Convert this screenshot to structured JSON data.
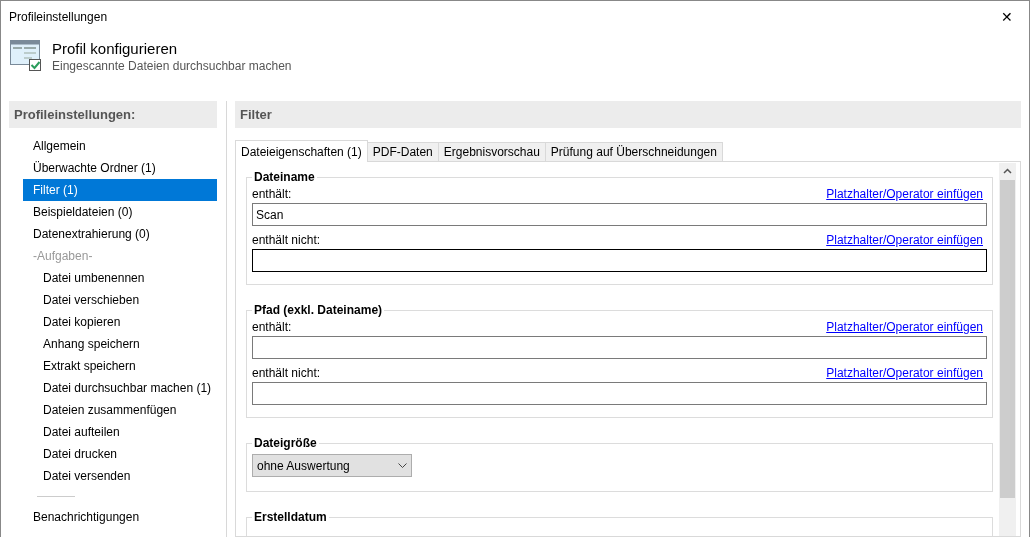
{
  "window": {
    "title": "Profileinstellungen",
    "close": "✕"
  },
  "header": {
    "title": "Profil konfigurieren",
    "subtitle": "Eingescannte Dateien durchsuchbar machen"
  },
  "sidebar": {
    "title": "Profileinstellungen:",
    "items": [
      {
        "kind": "item",
        "label": "Allgemein",
        "selected": false
      },
      {
        "kind": "item",
        "label": "Überwachte Ordner (1)",
        "selected": false
      },
      {
        "kind": "item",
        "label": "Filter (1)",
        "selected": true
      },
      {
        "kind": "item",
        "label": "Beispieldateien (0)",
        "selected": false
      },
      {
        "kind": "item",
        "label": "Datenextrahierung (0)",
        "selected": false
      },
      {
        "kind": "heading",
        "label": "-Aufgaben-"
      },
      {
        "kind": "subitem",
        "label": "Datei umbenennen",
        "selected": false
      },
      {
        "kind": "subitem",
        "label": "Datei verschieben",
        "selected": false
      },
      {
        "kind": "subitem",
        "label": "Datei kopieren",
        "selected": false
      },
      {
        "kind": "subitem",
        "label": "Anhang speichern",
        "selected": false
      },
      {
        "kind": "subitem",
        "label": "Extrakt speichern",
        "selected": false
      },
      {
        "kind": "subitem",
        "label": "Datei durchsuchbar machen (1)",
        "selected": false
      },
      {
        "kind": "subitem",
        "label": "Dateien zusammenfügen",
        "selected": false
      },
      {
        "kind": "subitem",
        "label": "Datei aufteilen",
        "selected": false
      },
      {
        "kind": "subitem",
        "label": "Datei drucken",
        "selected": false
      },
      {
        "kind": "subitem",
        "label": "Datei versenden",
        "selected": false
      },
      {
        "kind": "separator"
      },
      {
        "kind": "item",
        "label": "Benachrichtigungen",
        "selected": false
      }
    ]
  },
  "panel": {
    "title": "Filter",
    "tabs": [
      {
        "label": "Dateieigenschaften (1)",
        "selected": true
      },
      {
        "label": "PDF-Daten",
        "selected": false
      },
      {
        "label": "Ergebnisvorschau",
        "selected": false
      },
      {
        "label": "Prüfung auf Überschneidungen",
        "selected": false
      }
    ],
    "groups": [
      {
        "kind": "text",
        "title": "Dateiname",
        "fields": [
          {
            "label": "enthält:",
            "link": "Platzhalter/Operator einfügen",
            "value": "Scan",
            "focused": false
          },
          {
            "label": "enthält nicht:",
            "link": "Platzhalter/Operator einfügen",
            "focused": true
          }
        ]
      },
      {
        "kind": "text",
        "title": "Pfad (exkl. Dateiname)",
        "fields": [
          {
            "label": "enthält:",
            "link": "Platzhalter/Operator einfügen",
            "focused": false
          },
          {
            "label": "enthält nicht:",
            "link": "Platzhalter/Operator einfügen",
            "focused": false
          }
        ]
      },
      {
        "kind": "select",
        "title": "Dateigröße",
        "value": "ohne Auswertung"
      },
      {
        "kind": "empty",
        "title": "Erstelldatum"
      }
    ]
  }
}
